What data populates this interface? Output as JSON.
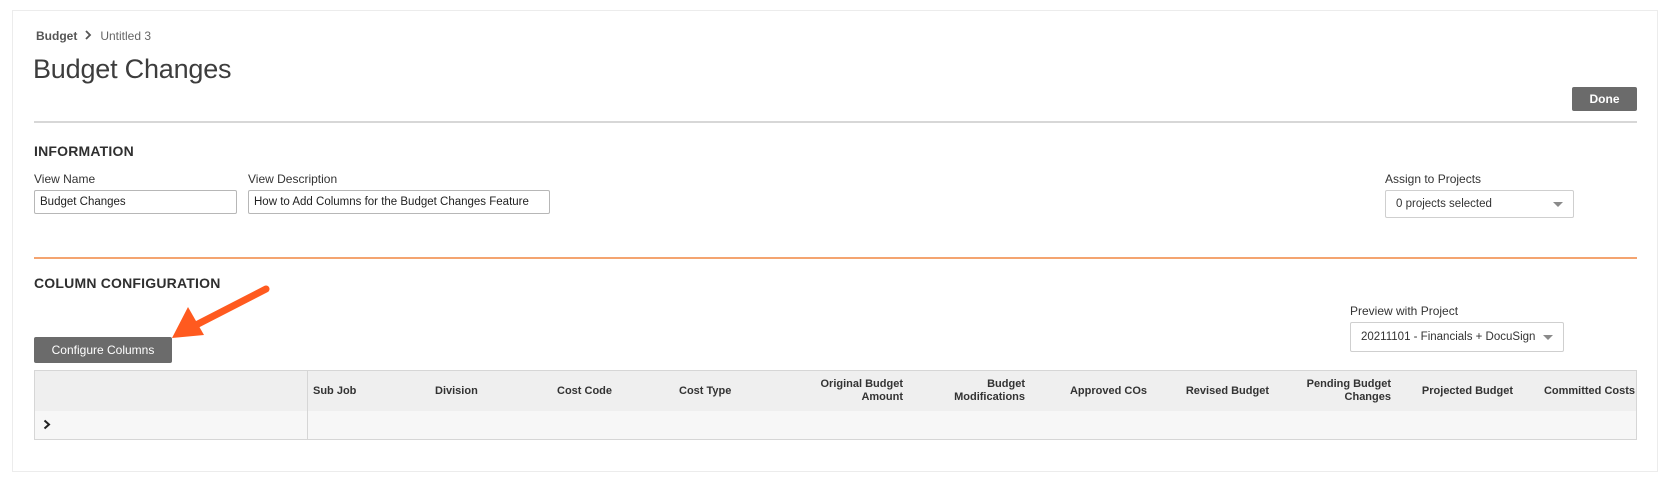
{
  "breadcrumb": {
    "root": "Budget",
    "current": "Untitled 3"
  },
  "page": {
    "title": "Budget Changes",
    "done_label": "Done"
  },
  "information": {
    "heading": "INFORMATION",
    "view_name_label": "View Name",
    "view_name_value": "Budget Changes",
    "view_description_label": "View Description",
    "view_description_value": "How to Add Columns for the Budget Changes Feature",
    "assign_label": "Assign to Projects",
    "assign_value": "0 projects selected"
  },
  "column_configuration": {
    "heading": "COLUMN CONFIGURATION",
    "configure_label": "Configure Columns",
    "preview_label": "Preview with Project",
    "preview_value": "20211101 - Financials + DocuSign..."
  },
  "grid": {
    "columns": [
      "Sub Job",
      "Division",
      "Cost Code",
      "Cost Type",
      "Original Budget Amount",
      "Budget Modifications",
      "Approved COs",
      "Revised Budget",
      "Pending Budget Changes",
      "Projected Budget",
      "Committed Costs"
    ]
  },
  "icons": {
    "breadcrumb_separator": "chevron-right-icon",
    "dropdown": "caret-down-icon",
    "annotation": "orange-arrow-icon",
    "row_expand": "chevron-right-icon"
  },
  "colors": {
    "button_bg": "#6b6b6b",
    "annotation_arrow": "#ff5a1f",
    "orange_divider": "#f4a470"
  }
}
